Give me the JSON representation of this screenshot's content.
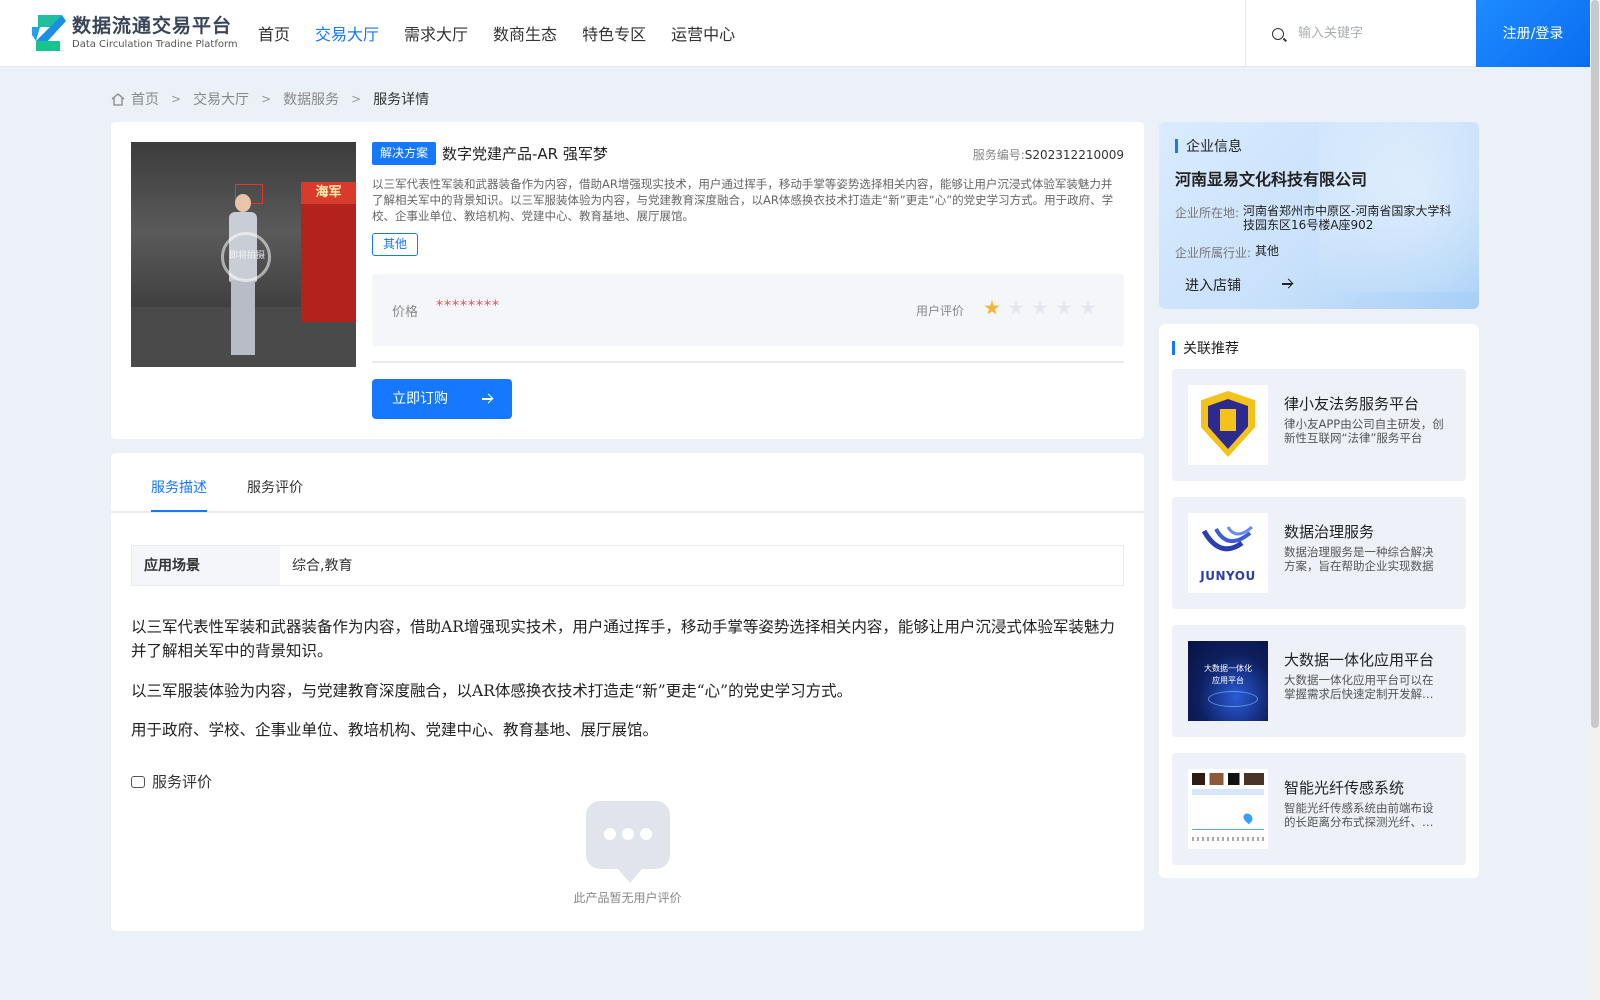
{
  "header": {
    "logo_cn": "数据流通交易平台",
    "logo_en": "Data Circulation Tradine Platform",
    "nav": [
      {
        "label": "首页",
        "active": false
      },
      {
        "label": "交易大厅",
        "active": true
      },
      {
        "label": "需求大厅",
        "active": false
      },
      {
        "label": "数商生态",
        "active": false
      },
      {
        "label": "特色专区",
        "active": false
      },
      {
        "label": "运营中心",
        "active": false
      }
    ],
    "search_placeholder": "输入关键字",
    "login_label": "注册/登录"
  },
  "breadcrumb": {
    "home": "首页",
    "level1": "交易大厅",
    "level2": "数据服务",
    "current": "服务详情",
    "separator": ">"
  },
  "product": {
    "tag": "解决方案",
    "title": "数字党建产品-AR 强军梦",
    "service_no_label": "服务编号:",
    "service_no": "S202312210009",
    "description": "以三军代表性军装和武器装备作为内容，借助AR增强现实技术，用户通过挥手，移动手掌等姿势选择相关内容，能够让用户沉浸式体验军装魅力并了解相关军中的背景知识。以三军服装体验为内容，与党建教育深度融合，以AR体感换衣技术打造走“新”更走“心”的党史学习方式。用于政府、学校、企事业单位、教培机构、党建中心、教育基地、展厅展馆。",
    "category_tag": "其他",
    "image_wall_text": "海军",
    "image_overlay_text": "即将拍摄",
    "price_label": "价格",
    "price_value": "********",
    "rating_label": "用户评价",
    "rating": 1,
    "rating_max": 5,
    "buy_label": "立即订购"
  },
  "tabs": {
    "items": [
      {
        "label": "服务描述",
        "active": true
      },
      {
        "label": "服务评价",
        "active": false
      }
    ],
    "scene_key": "应用场景",
    "scene_value": "综合,教育",
    "paragraphs": [
      "以三军代表性军装和武器装备作为内容，借助AR增强现实技术，用户通过挥手，移动手掌等姿势选择相关内容，能够让用户沉浸式体验军装魅力并了解相关军中的背景知识。",
      "以三军服装体验为内容，与党建教育深度融合，以AR体感换衣技术打造走“新”更走“心”的党史学习方式。",
      "用于政府、学校、企事业单位、教培机构、党建中心、教育基地、展厅展馆。"
    ],
    "review_title": "服务评价",
    "empty_text": "此产品暂无用户评价"
  },
  "company": {
    "section_title": "企业信息",
    "name": "河南显易文化科技有限公司",
    "location_label": "企业所在地:",
    "location": "河南省郑州市中原区-河南省国家大学科技园东区16号楼A座902",
    "industry_label": "企业所属行业:",
    "industry": "其他",
    "shop_label": "进入店铺"
  },
  "recommend": {
    "section_title": "关联推荐",
    "items": [
      {
        "name": "律小友法务服务平台",
        "desc": "律小友APP由公司自主研发，创新性互联网“法律”服务平台"
      },
      {
        "name": "数据治理服务",
        "desc": "数据治理服务是一种综合解决方案，旨在帮助企业实现数据"
      },
      {
        "name": "大数据一体化应用平台",
        "desc": "大数据一体化应用平台可以在掌握需求后快速定制开发解决方案"
      },
      {
        "name": "智能光纤传感系统",
        "desc": "智能光纤传感系统由前端布设的长距离分布式探测光纤、主机"
      }
    ],
    "thumb_texts": {
      "junyou": "JUNYOU",
      "bigdata_line1": "大数据一体化",
      "bigdata_line2": "应用平台"
    }
  },
  "colors": {
    "primary": "#1677ff",
    "price": "#f04b4b",
    "star_on": "#f5b52c",
    "star_off": "#e4e7ed",
    "page_bg": "#ecf0f7"
  }
}
